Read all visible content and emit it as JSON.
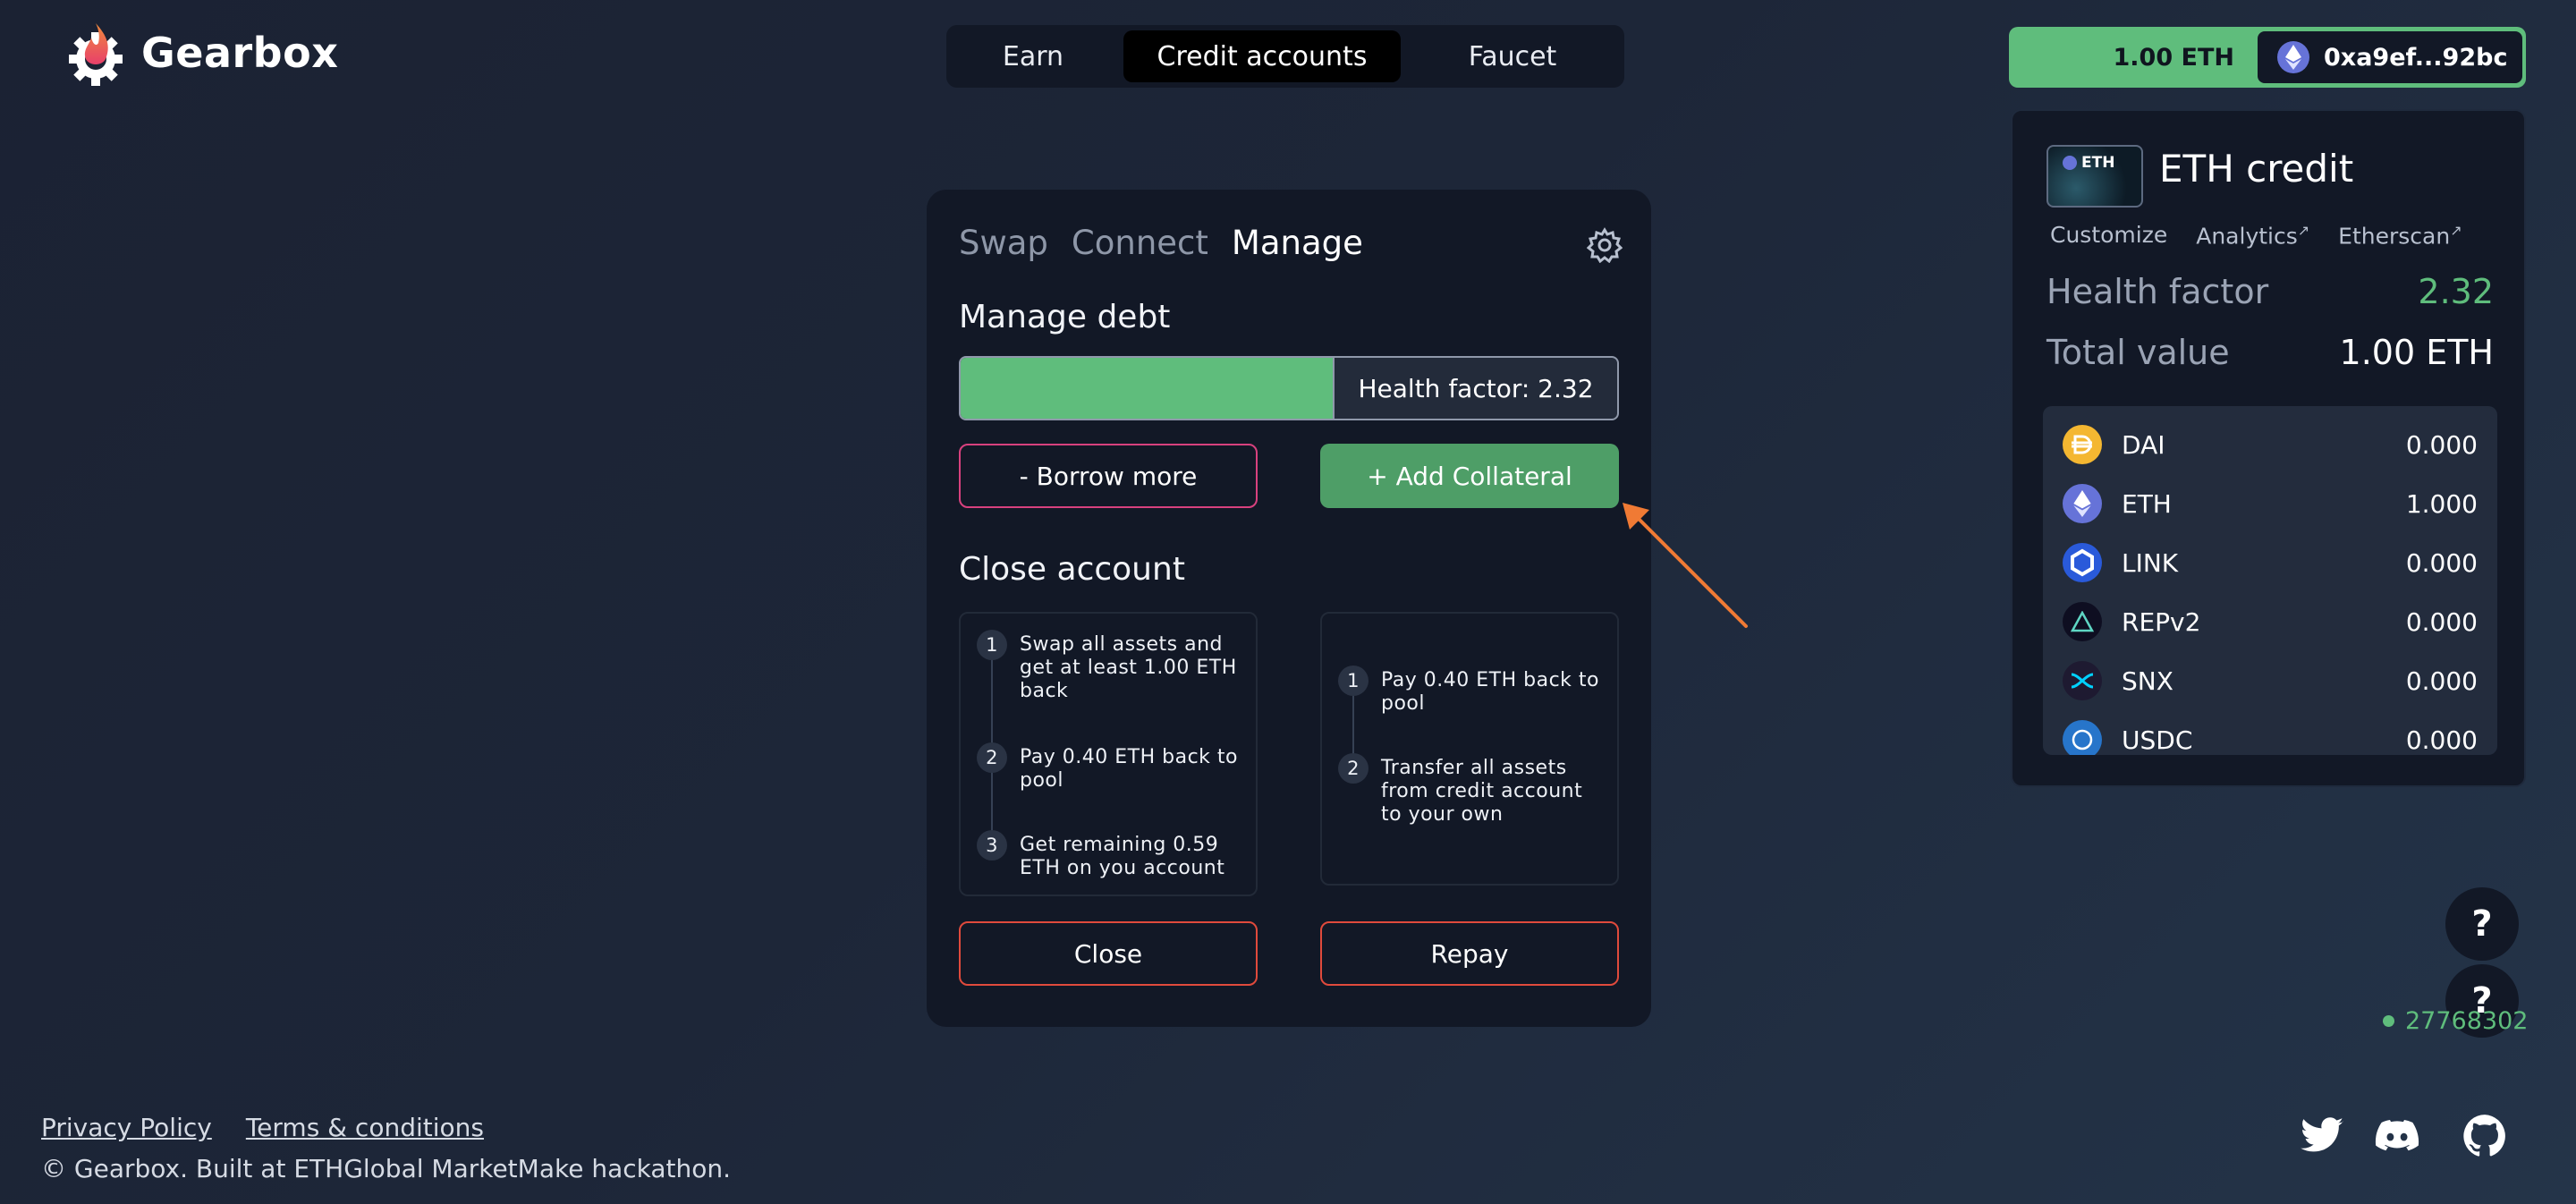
{
  "header": {
    "brand": "Gearbox",
    "nav": [
      "Earn",
      "Credit accounts",
      "Faucet"
    ],
    "active_nav": "Credit accounts",
    "wallet": {
      "balance": "1.00 ETH",
      "address": "0xa9ef...92bc"
    }
  },
  "credit_card": {
    "thumb_label": "ETH",
    "title": "ETH credit",
    "links": [
      "Customize",
      "Analytics",
      "Etherscan"
    ],
    "link_arrow": "↗",
    "health_factor_label": "Health factor",
    "health_factor_value": "2.32",
    "total_value_label": "Total value",
    "total_value": "1.00 ETH",
    "assets": [
      {
        "name": "DAI",
        "value": "0.000",
        "icon": "dai-icon",
        "color": "#f4b731"
      },
      {
        "name": "ETH",
        "value": "1.000",
        "icon": "eth-icon",
        "color": "#6673d8"
      },
      {
        "name": "LINK",
        "value": "0.000",
        "icon": "link-icon",
        "color": "#2a5ada"
      },
      {
        "name": "REPv2",
        "value": "0.000",
        "icon": "rep-icon",
        "color": "#0e0e21"
      },
      {
        "name": "SNX",
        "value": "0.000",
        "icon": "snx-icon",
        "color": "#1e1a31"
      },
      {
        "name": "USDC",
        "value": "0.000",
        "icon": "usdc-icon",
        "color": "#2775ca"
      }
    ]
  },
  "panel": {
    "tabs": [
      "Swap",
      "Connect",
      "Manage"
    ],
    "active_tab": "Manage",
    "manage_title": "Manage debt",
    "health_bar_label": "Health factor: 2.32",
    "health_bar_fill": 0.57,
    "borrow_label": "- Borrow more",
    "add_label": "+ Add Collateral",
    "close_title": "Close account",
    "close_steps": [
      "Swap all assets and get at least 1.00 ETH back",
      "Pay 0.40 ETH back to pool",
      "Get remaining 0.59 ETH on you account"
    ],
    "repay_steps": [
      "Pay 0.40 ETH back to pool",
      "Transfer all assets from credit account to your own"
    ],
    "close_button": "Close",
    "repay_button": "Repay"
  },
  "help": [
    "?",
    "?"
  ],
  "block_number": "27768302",
  "footer": {
    "links": [
      "Privacy Policy",
      "Terms & conditions"
    ],
    "copyright": "© Gearbox. Built at ETHGlobal MarketMake hackathon."
  },
  "colors": {
    "accent_green": "#5fbd7c",
    "danger": "#e04a3c",
    "pink": "#d8417e",
    "arrow": "#f07a34"
  }
}
